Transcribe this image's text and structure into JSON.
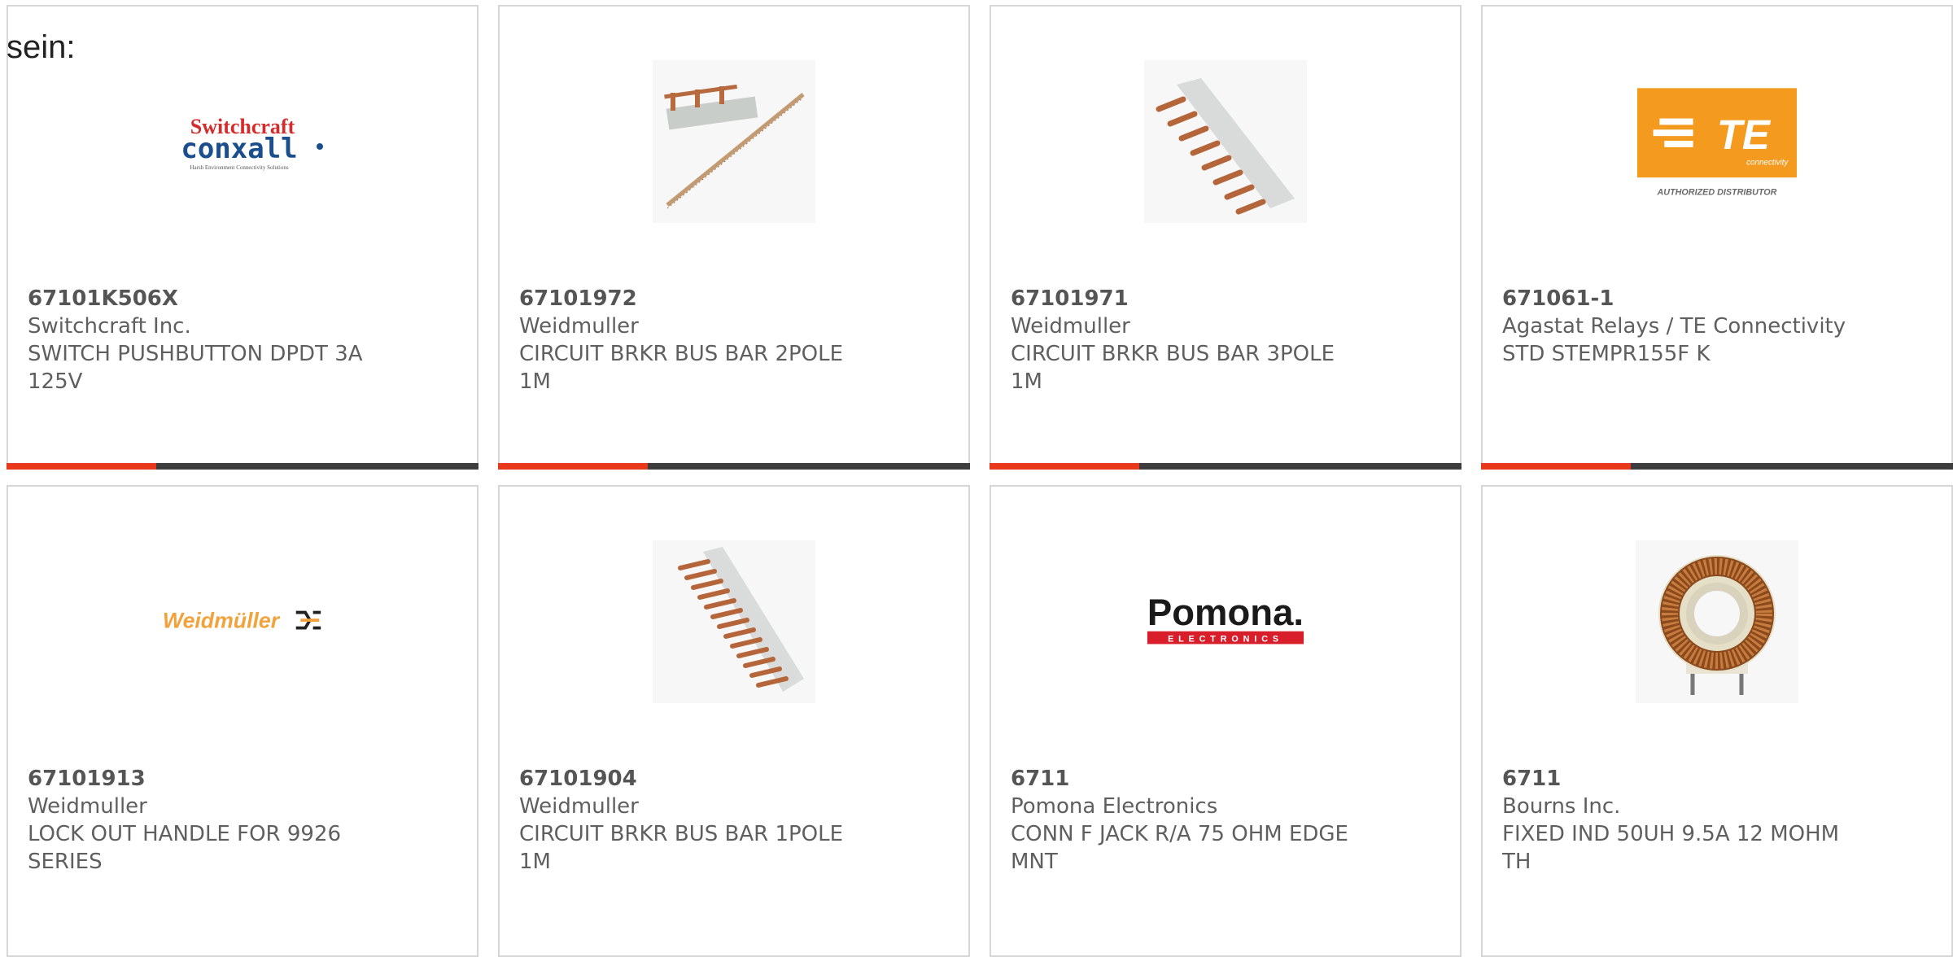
{
  "intro_text": "sein:",
  "brand_colors": {
    "accent": "#e8391d",
    "bar": "#3d3d3d",
    "border": "#d6d6d6"
  },
  "products": [
    {
      "part_number": "67101K506X",
      "manufacturer": "Switchcraft Inc.",
      "description": "SWITCH PUSHBUTTON DPDT 3A 125V",
      "image": "switchcraft-conxall-logo",
      "logo_text": "Switchcraft",
      "logo_text2": "conxall",
      "logo_tagline": "Harsh Environment Connectivity Solutions"
    },
    {
      "part_number": "67101972",
      "manufacturer": "Weidmuller",
      "description": "CIRCUIT BRKR BUS BAR 2POLE 1M",
      "image": "bus-bar-2pole-photo"
    },
    {
      "part_number": "67101971",
      "manufacturer": "Weidmuller",
      "description": "CIRCUIT BRKR BUS BAR 3POLE 1M",
      "image": "bus-bar-3pole-photo"
    },
    {
      "part_number": "671061-1",
      "manufacturer": "Agastat Relays / TE Connectivity",
      "description": "STD STEMPR155F K",
      "image": "te-connectivity-logo",
      "logo_text": "TE",
      "logo_text2": "connectivity",
      "logo_tagline": "AUTHORIZED DISTRIBUTOR"
    },
    {
      "part_number": "67101913",
      "manufacturer": "Weidmuller",
      "description": "LOCK OUT HANDLE FOR 9926 SERIES",
      "image": "weidmuller-logo",
      "logo_text": "Weidmüller"
    },
    {
      "part_number": "67101904",
      "manufacturer": "Weidmuller",
      "description": "CIRCUIT BRKR BUS BAR 1POLE 1M",
      "image": "bus-bar-1pole-photo"
    },
    {
      "part_number": "6711",
      "manufacturer": "Pomona Electronics",
      "description": "CONN F JACK R/A 75 OHM EDGE MNT",
      "image": "pomona-logo",
      "logo_text": "Pomona.",
      "logo_text2": "ELECTRONICS"
    },
    {
      "part_number": "6711",
      "manufacturer": "Bourns Inc.",
      "description": "FIXED IND 50UH 9.5A 12 MOHM TH",
      "image": "toroid-inductor-photo"
    }
  ]
}
